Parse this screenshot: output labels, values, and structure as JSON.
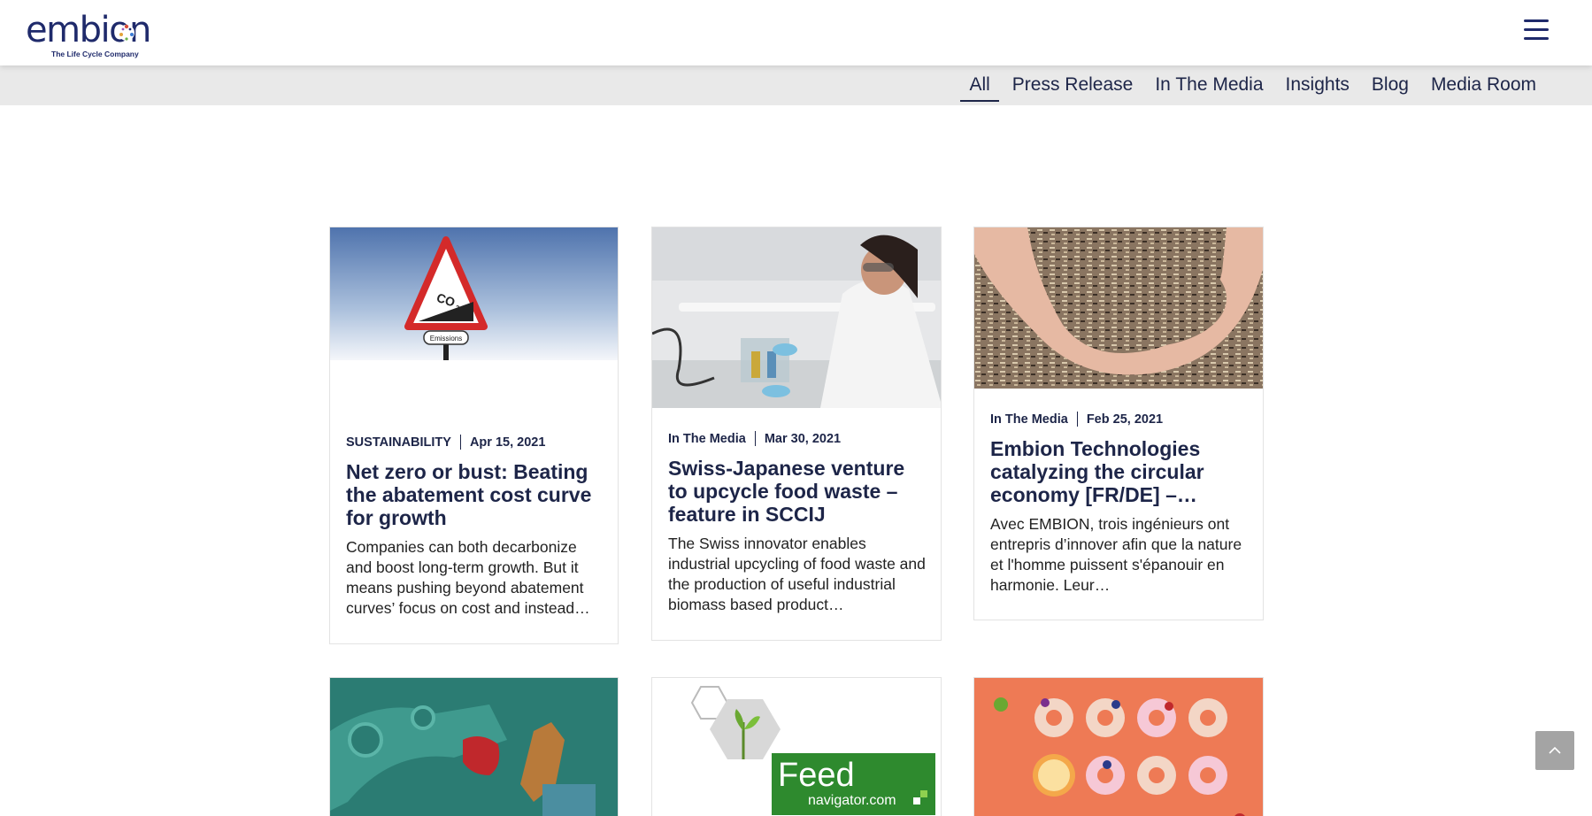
{
  "header": {
    "logo_text": "embion",
    "logo_tagline": "The Life Cycle Company",
    "menu_icon": "hamburger-menu-icon"
  },
  "filters": [
    {
      "label": "All",
      "active": true
    },
    {
      "label": "Press Release",
      "active": false
    },
    {
      "label": "In The Media",
      "active": false
    },
    {
      "label": "Insights",
      "active": false
    },
    {
      "label": "Blog",
      "active": false
    },
    {
      "label": "Media Room",
      "active": false
    }
  ],
  "posts": [
    {
      "category": "SUSTAINABILITY",
      "date": "Apr 15, 2021",
      "title": "Net zero or bust: Beating the abatement cost curve for growth",
      "excerpt": "Companies can both decarbonize and boost long-term growth. But it means pushing beyond abatement curves’ focus on cost and instead…",
      "image_sign_text": "CO",
      "image_sign_subscript": "2",
      "image_plate_text": "Emissions"
    },
    {
      "category": "In The Media",
      "date": "Mar 30, 2021",
      "title": "Swiss-Japanese venture to upcycle food waste – feature in SCCIJ",
      "excerpt": "The Swiss innovator enables industrial upcycling of food waste and the production of useful industrial biomass based product…"
    },
    {
      "category": "In The Media",
      "date": "Feb 25, 2021",
      "title": "Embion Technologies catalyzing the circular economy [FR/DE] –…",
      "excerpt": "Avec EMBION, trois ingénieurs ont entrepris d’innover afin que la nature et l'homme puissent s'épanouir en harmonie. Leur…"
    },
    {
      "image": "robot-arm-pepper-illustration"
    },
    {
      "image": "feednavigator-logo-image",
      "image_text_main": "Feed",
      "image_text_sub": "navigator.com"
    },
    {
      "image": "fruit-donuts-image"
    }
  ],
  "colors": {
    "brand": "#1f2a6b",
    "filterbar_bg": "#e9e9e9",
    "text": "#1d2548"
  }
}
